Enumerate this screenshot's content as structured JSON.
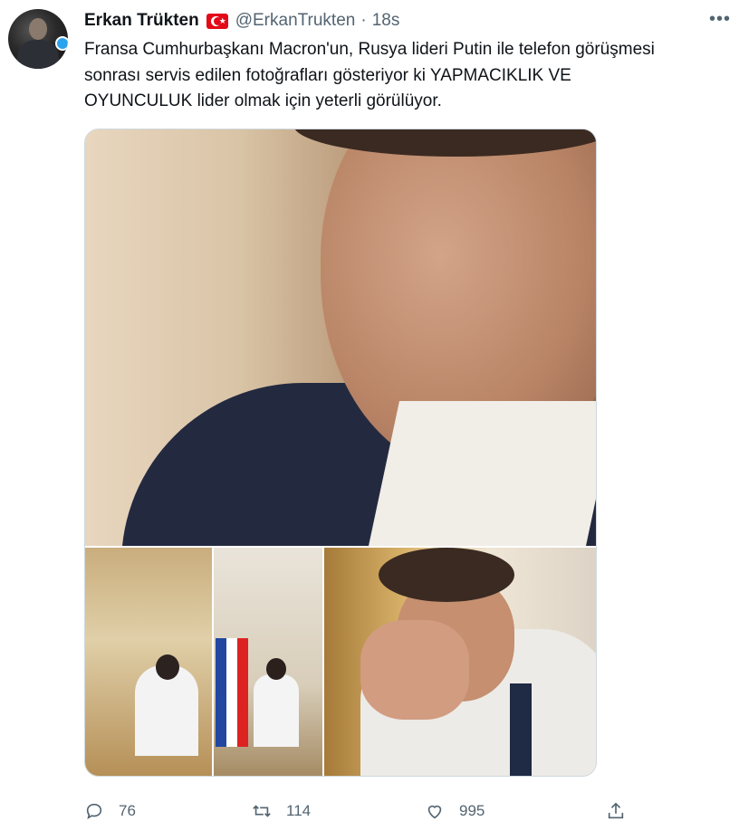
{
  "tweet": {
    "author_name": "Erkan Trükten",
    "author_handle": "@ErkanTrukten",
    "separator": "·",
    "time": "18s",
    "flag": "turkey-flag",
    "more_label": "•••",
    "text": "Fransa Cumhurbaşkanı Macron'un, Rusya lideri Putin ile  telefon görüşmesi\nsonrası servis edilen fotoğrafları gösteriyor ki YAPMACIKLIK VE\nOYUNCULUK lider olmak için yeterli görülüyor.",
    "media_count": 4
  },
  "actions": {
    "reply_count": "76",
    "retweet_count": "114",
    "like_count": "995",
    "icons": [
      "reply-icon",
      "retweet-icon",
      "like-icon",
      "share-icon"
    ]
  },
  "colors": {
    "text": "#0f1419",
    "secondary": "#536471",
    "border": "#cfd9de",
    "flag_red": "#e30a17"
  }
}
